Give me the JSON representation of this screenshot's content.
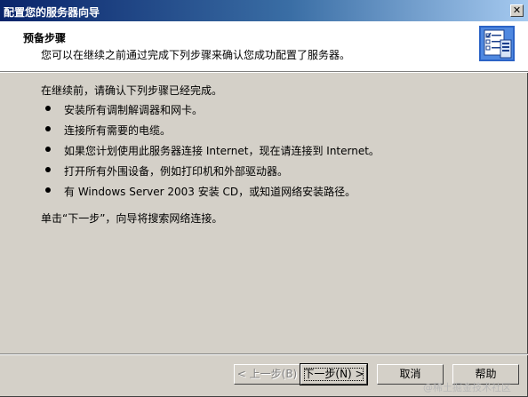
{
  "window": {
    "title": "配置您的服务器向导",
    "close_glyph": "✕"
  },
  "header": {
    "title": "预备步骤",
    "subtitle": "您可以在继续之前通过完成下列步骤来确认您成功配置了服务器。",
    "icon": "server-checklist-icon"
  },
  "body": {
    "intro": "在继续前，请确认下列步骤已经完成。",
    "bullets": [
      "安装所有调制解调器和网卡。",
      "连接所有需要的电缆。",
      "如果您计划使用此服务器连接 Internet，现在请连接到 Internet。",
      "打开所有外围设备，例如打印机和外部驱动器。",
      "有 Windows Server 2003 安装 CD，或知道网络安装路径。"
    ],
    "outro": "单击“下一步”，向导将搜索网络连接。"
  },
  "buttons": {
    "back": "< 上一步(B)",
    "next": "下一步(N) >",
    "cancel": "取消",
    "help": "帮助"
  },
  "watermark": "@稀土掘金技术社区",
  "colors": {
    "title_start": "#0a246a",
    "title_end": "#a6caf0",
    "face": "#d4d0c8"
  }
}
